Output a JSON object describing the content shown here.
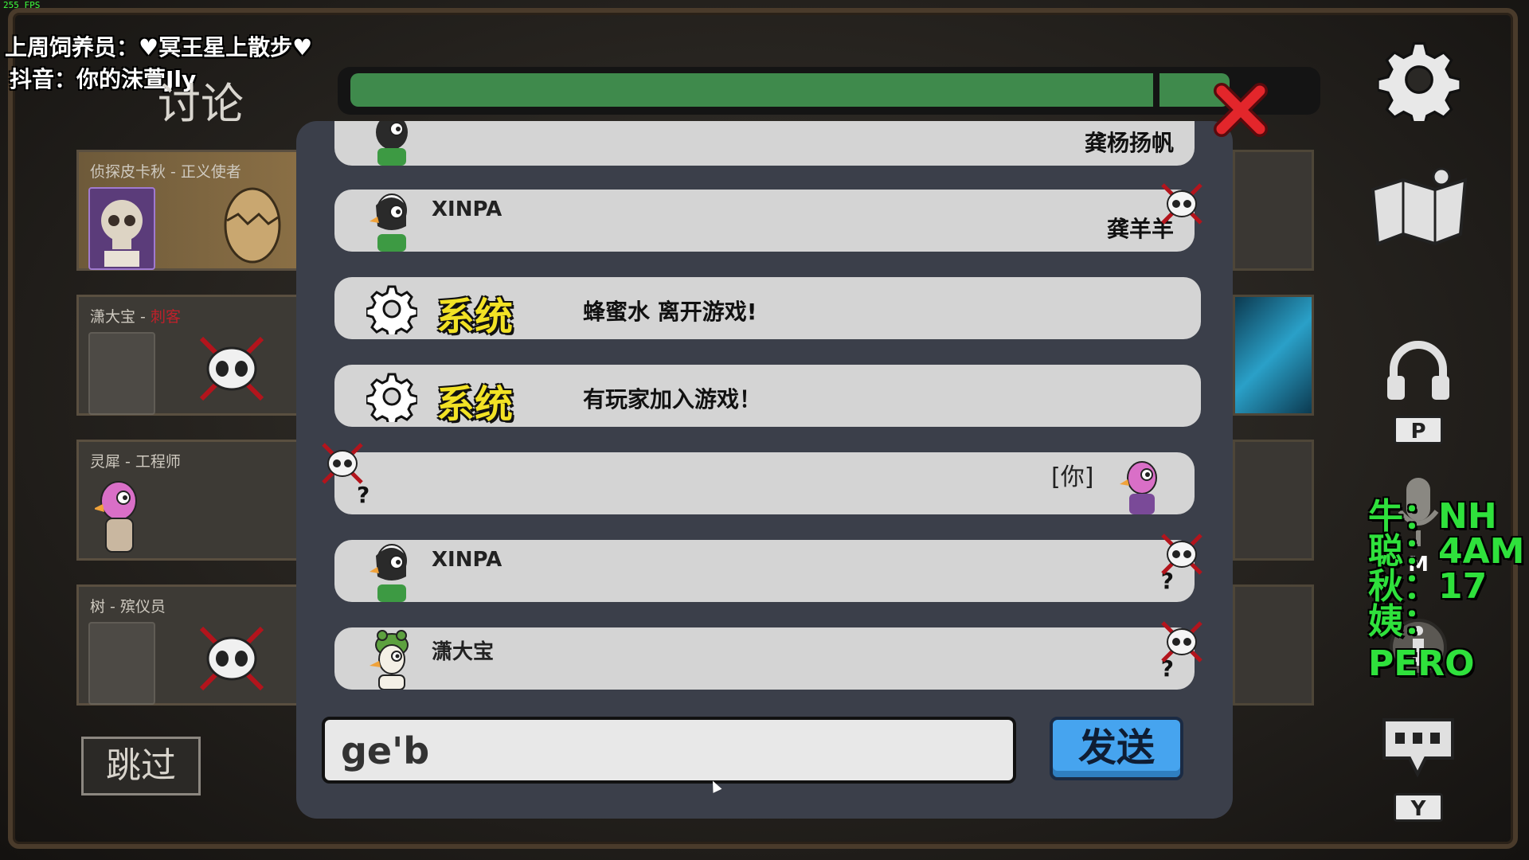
{
  "fps": "255 FPS",
  "overlay": {
    "line1": "上周饲养员：♥冥王星上散步♥",
    "line2": "抖音：你的沫萱Jly"
  },
  "discussion_title": "讨论",
  "players_left": [
    {
      "name": "侦探皮卡秋 - 正义使者",
      "role_red": "",
      "status": "alive"
    },
    {
      "name": "潇大宝 - ",
      "role_red": "刺客",
      "status": "dead"
    },
    {
      "name": "灵犀 - 工程师",
      "role_red": "",
      "status": "alive"
    },
    {
      "name": "树 - 殡仪员",
      "role_red": "",
      "status": "dead"
    }
  ],
  "skip_label": "跳过",
  "timer": {
    "remaining_fraction": 0.92
  },
  "chat": {
    "messages": [
      {
        "type": "player",
        "name": "",
        "text": "龚杨扬帆"
      },
      {
        "type": "player",
        "name": "XINPA",
        "text": "龚羊羊"
      },
      {
        "type": "system",
        "label": "系统",
        "text": "蜂蜜水 离开游戏!"
      },
      {
        "type": "system",
        "label": "系统",
        "text": "有玩家加入游戏！"
      },
      {
        "type": "self",
        "name": "[你]",
        "text": "?"
      },
      {
        "type": "player",
        "name": "XINPA",
        "text": "?"
      },
      {
        "type": "player",
        "name": "潇大宝",
        "text": "?"
      }
    ],
    "input_value": "ge'b",
    "send_label": "发送"
  },
  "hud": {
    "push_to_talk_key": "P",
    "mute_key": "M",
    "chat_key": "Y"
  },
  "notes": [
    {
      "label": "牛：",
      "value": "NH"
    },
    {
      "label": "聪：",
      "value": "4AM"
    },
    {
      "label": "秋：",
      "value": "17"
    },
    {
      "label": "姨：",
      "value": "PERO"
    }
  ],
  "colors": {
    "timer_green": "#3f8a4c",
    "system_yellow": "#f2e225",
    "send_blue": "#46a4ef",
    "close_red": "#e3262b",
    "note_green": "#2fe13c"
  }
}
